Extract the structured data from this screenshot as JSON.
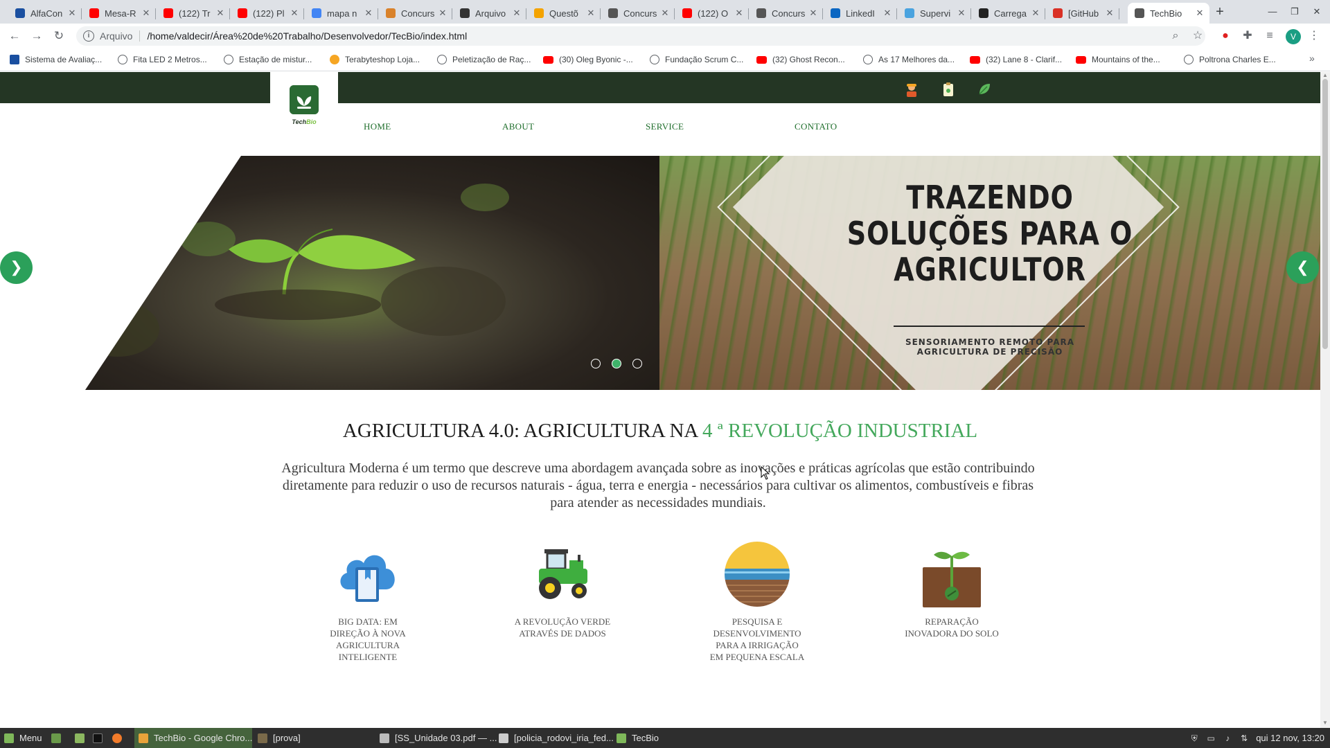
{
  "browser": {
    "tabs": [
      {
        "title": "AlfaCon",
        "icon": "alfacon-icon",
        "color": "#1a4fa0"
      },
      {
        "title": "Mesa-R",
        "icon": "youtube-icon",
        "color": "#ff0000"
      },
      {
        "title": "(122) Tr",
        "icon": "youtube-icon",
        "color": "#ff0000"
      },
      {
        "title": "(122) Pl",
        "icon": "youtube-icon",
        "color": "#ff0000"
      },
      {
        "title": "mapa n",
        "icon": "google-icon",
        "color": "#4285f4"
      },
      {
        "title": "Concurs",
        "icon": "folder-icon",
        "color": "#d9822b"
      },
      {
        "title": "Arquivo",
        "icon": "pin-icon",
        "color": "#333333"
      },
      {
        "title": "Questõ",
        "icon": "quiz-icon",
        "color": "#f4a300"
      },
      {
        "title": "Concurs",
        "icon": "globe-icon",
        "color": "#555555"
      },
      {
        "title": "(122) O",
        "icon": "youtube-icon",
        "color": "#ff0000"
      },
      {
        "title": "Concurs",
        "icon": "globe-icon",
        "color": "#555555"
      },
      {
        "title": "LinkedI",
        "icon": "linkedin-icon",
        "color": "#0a66c2"
      },
      {
        "title": "Supervi",
        "icon": "supervi-icon",
        "color": "#4aa3df"
      },
      {
        "title": "Carrega",
        "icon": "github-icon",
        "color": "#222222"
      },
      {
        "title": "[GitHub",
        "icon": "gmail-icon",
        "color": "#d93025"
      },
      {
        "title": "TechBio",
        "icon": "globe-icon",
        "color": "#555555",
        "active": true
      }
    ],
    "address": {
      "chip": "Arquivo",
      "url": "/home/valdecir/Área%20de%20Trabalho/Desenvolvedor/TecBio/index.html"
    },
    "profile_initial": "V",
    "bookmarks": [
      {
        "label": "Sistema de Avaliaç...",
        "icon": "ac"
      },
      {
        "label": "Fita LED 2 Metros...",
        "icon": "globe"
      },
      {
        "label": "Estação de mistur...",
        "icon": "globe"
      },
      {
        "label": "Terabyteshop Loja...",
        "icon": "tb"
      },
      {
        "label": "Peletização de Raç...",
        "icon": "globe"
      },
      {
        "label": "(30) Oleg Byonic -...",
        "icon": "yt"
      },
      {
        "label": "Fundação Scrum C...",
        "icon": "globe"
      },
      {
        "label": "(32) Ghost Recon...",
        "icon": "yt"
      },
      {
        "label": "As 17 Melhores da...",
        "icon": "globe"
      },
      {
        "label": "(32) Lane 8 - Clarif...",
        "icon": "yt"
      },
      {
        "label": "Mountains of the...",
        "icon": "yt"
      },
      {
        "label": "Poltrona Charles E...",
        "icon": "globe"
      }
    ],
    "bookmarks_more": "»"
  },
  "site": {
    "logo": {
      "text_a": "Tech",
      "text_b": "Bio"
    },
    "nav": [
      "HOME",
      "ABOUT",
      "SERVICE",
      "CONTATO"
    ],
    "slide": {
      "headline_lines": [
        "TRAZENDO",
        "SOLUÇÕES PARA O",
        "AGRICULTOR"
      ],
      "sub_lines": [
        "SENSORIAMENTO REMOTO PARA",
        "AGRICULTURA DE PRECISÃO"
      ],
      "active_dot": 2,
      "dots": 3
    },
    "headline": {
      "main": "AGRICULTURA 4.0: AGRICULTURA NA ",
      "accent": "4 ª REVOLUÇÃO INDUSTRIAL"
    },
    "intro": "Agricultura Moderna é um termo que descreve uma abordagem avançada sobre as inovações e práticas agrícolas que estão contribuindo diretamente para reduzir o uso de recursos naturais - água, terra e energia - necessários para cultivar os alimentos, combustíveis e fibras para atender as necessidades mundiais.",
    "features": [
      {
        "icon": "cloud-book-icon",
        "label": "BIG DATA: EM DIREÇÃO À NOVA AGRICULTURA INTELIGENTE"
      },
      {
        "icon": "tractor-icon",
        "label": "A REVOLUÇÃO VERDE ATRAVÉS DE DADOS"
      },
      {
        "icon": "irrigation-field-icon",
        "label": "PESQUISA E DESENVOLVIMENTO PARA A IRRIGAÇÃO EM PEQUENA ESCALA"
      },
      {
        "icon": "soil-sprout-icon",
        "label": "REPARAÇÃO INOVADORA DO SOLO"
      }
    ]
  },
  "taskbar": {
    "menu": "Menu",
    "items": [
      {
        "label": "TechBio - Google Chro...",
        "active": true
      },
      {
        "label": "[prova]"
      },
      {
        "label": "[SS_Unidade 03.pdf — ..."
      },
      {
        "label": "[policia_rodovi_iria_fed..."
      },
      {
        "label": "TecBio"
      }
    ],
    "clock": "qui 12 nov, 13:20"
  }
}
